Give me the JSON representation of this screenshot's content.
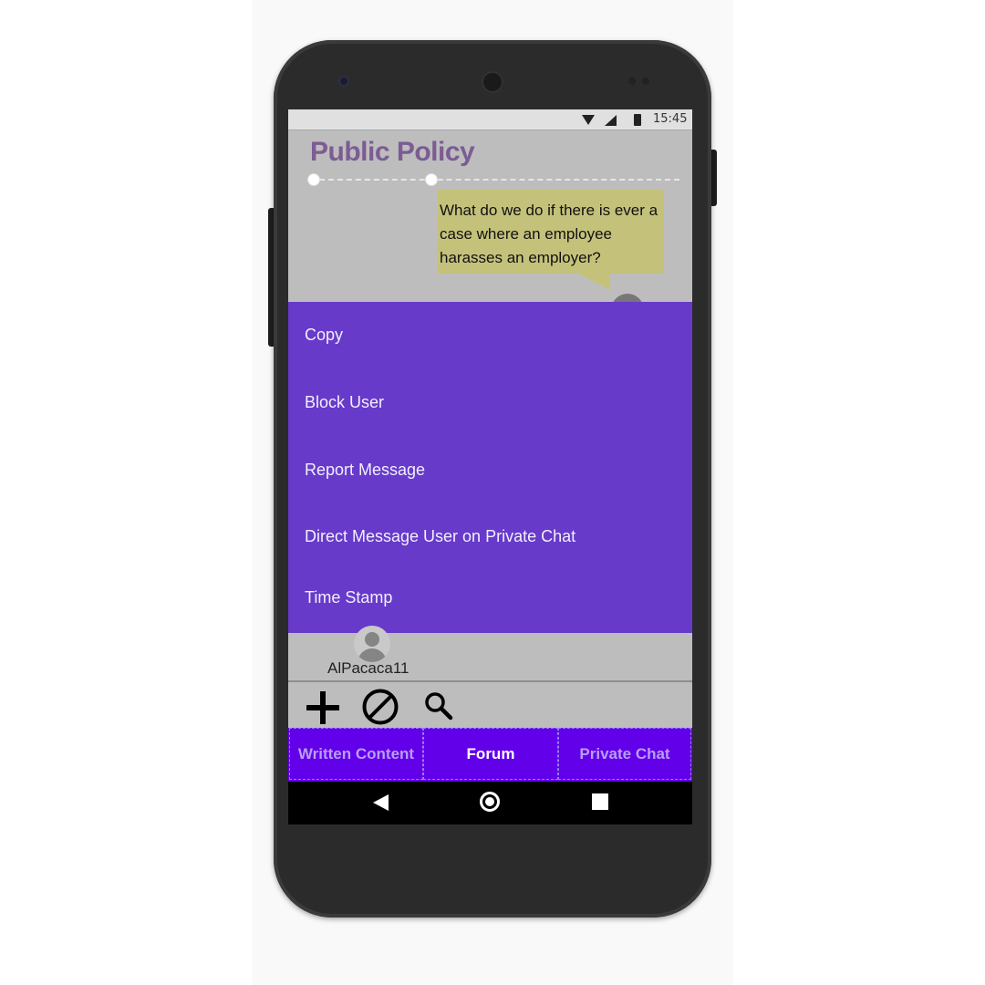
{
  "status_bar": {
    "time": "15:45"
  },
  "page": {
    "title": "Public Policy"
  },
  "message": {
    "text": "What do we do if there is ever a case where an employee harasses an employer?"
  },
  "context_menu": {
    "items": [
      {
        "label": "Copy"
      },
      {
        "label": "Block User"
      },
      {
        "label": "Report Message"
      },
      {
        "label": "Direct Message User on Private Chat"
      },
      {
        "label": "Time Stamp"
      }
    ]
  },
  "user": {
    "name": "AlPacaca11"
  },
  "toolbar": {
    "icons": [
      "add-icon",
      "block-icon",
      "search-icon"
    ]
  },
  "tabs": [
    {
      "label": "Written Content",
      "active": false
    },
    {
      "label": "Forum",
      "active": true
    },
    {
      "label": "Private Chat",
      "active": false
    }
  ],
  "colors": {
    "menu_bg": "#673ac9",
    "tab_bg": "#6200ea",
    "title": "#7c5c94",
    "bubble": "#c4c27a"
  }
}
